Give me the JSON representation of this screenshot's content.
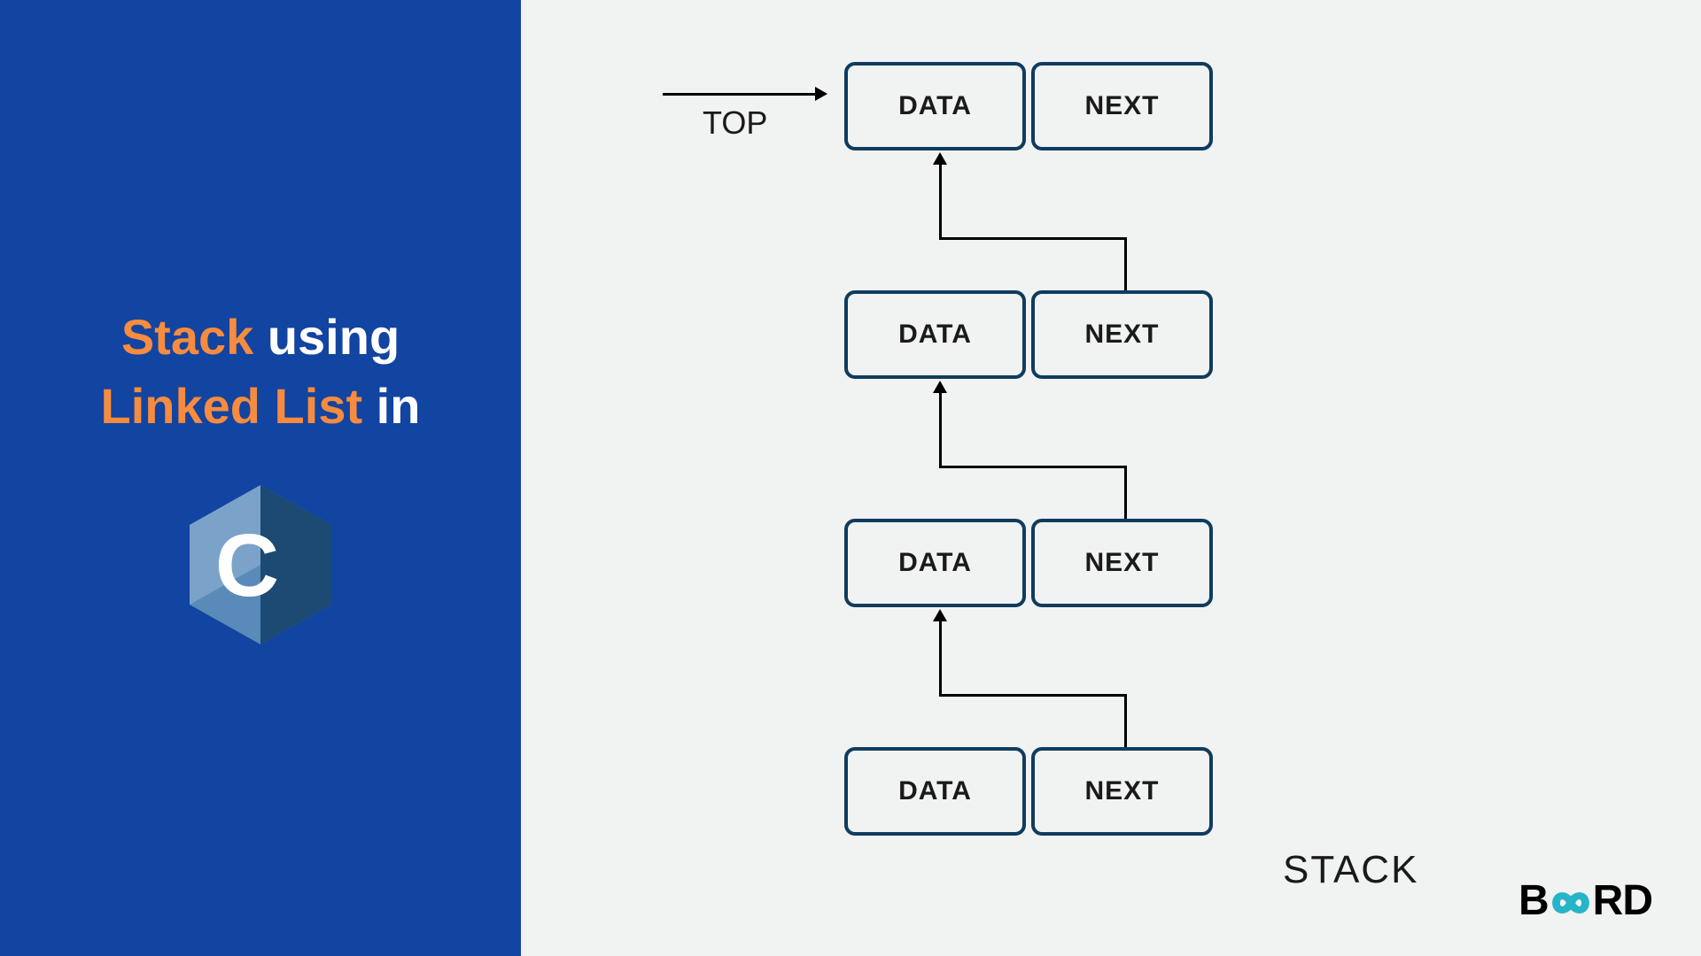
{
  "title": {
    "word1": "Stack",
    "word2": " using ",
    "word3": "Linked List",
    "word4": " in"
  },
  "cpp_label": "++",
  "diagram": {
    "top_label": "TOP",
    "stack_label": "STACK",
    "nodes": [
      {
        "data": "DATA",
        "next": "NEXT"
      },
      {
        "data": "DATA",
        "next": "NEXT"
      },
      {
        "data": "DATA",
        "next": "NEXT"
      },
      {
        "data": "DATA",
        "next": "NEXT"
      }
    ]
  },
  "brand": {
    "b": "B",
    "infinity": "∞",
    "rd": "RD"
  },
  "colors": {
    "blue_panel": "#1244a1",
    "orange_text": "#f78b3e",
    "node_border": "#0f3c5e",
    "bg_light": "#f1f2f2"
  }
}
